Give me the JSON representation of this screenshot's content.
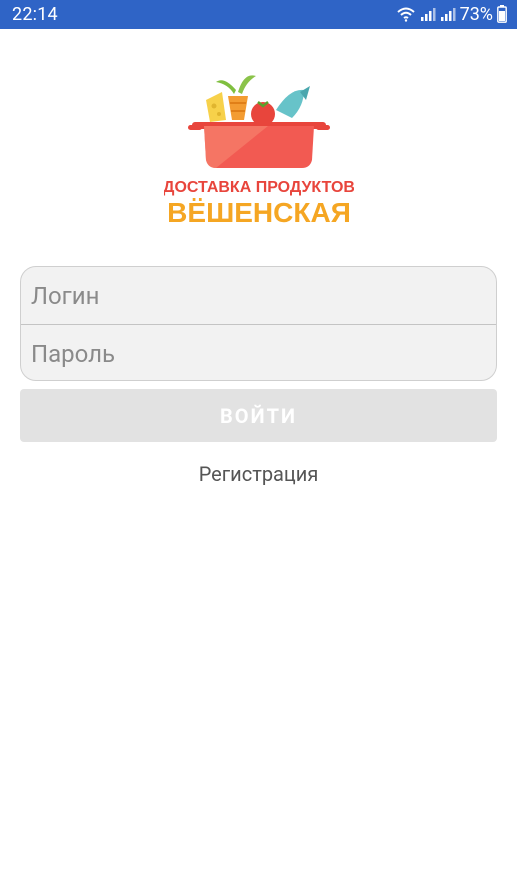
{
  "status_bar": {
    "time": "22:14",
    "battery_percent": "73%",
    "icons": [
      "wifi-icon",
      "signal-icon",
      "signal-icon",
      "battery-icon"
    ]
  },
  "logo": {
    "line1": "ДОСТАВКА ПРОДУКТОВ",
    "line2": "ВЁШЕНСКАЯ",
    "colors": {
      "pot": "#f25a52",
      "line1": "#e8453c",
      "line2": "#f5a623"
    }
  },
  "form": {
    "login_placeholder": "Логин",
    "password_placeholder": "Пароль",
    "login_value": "",
    "password_value": ""
  },
  "login_button": {
    "label": "ВОЙТИ"
  },
  "register_link": {
    "label": "Регистрация"
  },
  "colors": {
    "status_bar": "#2f64c6",
    "field_bg": "#f2f2f2",
    "button_bg": "#e2e2e2"
  }
}
